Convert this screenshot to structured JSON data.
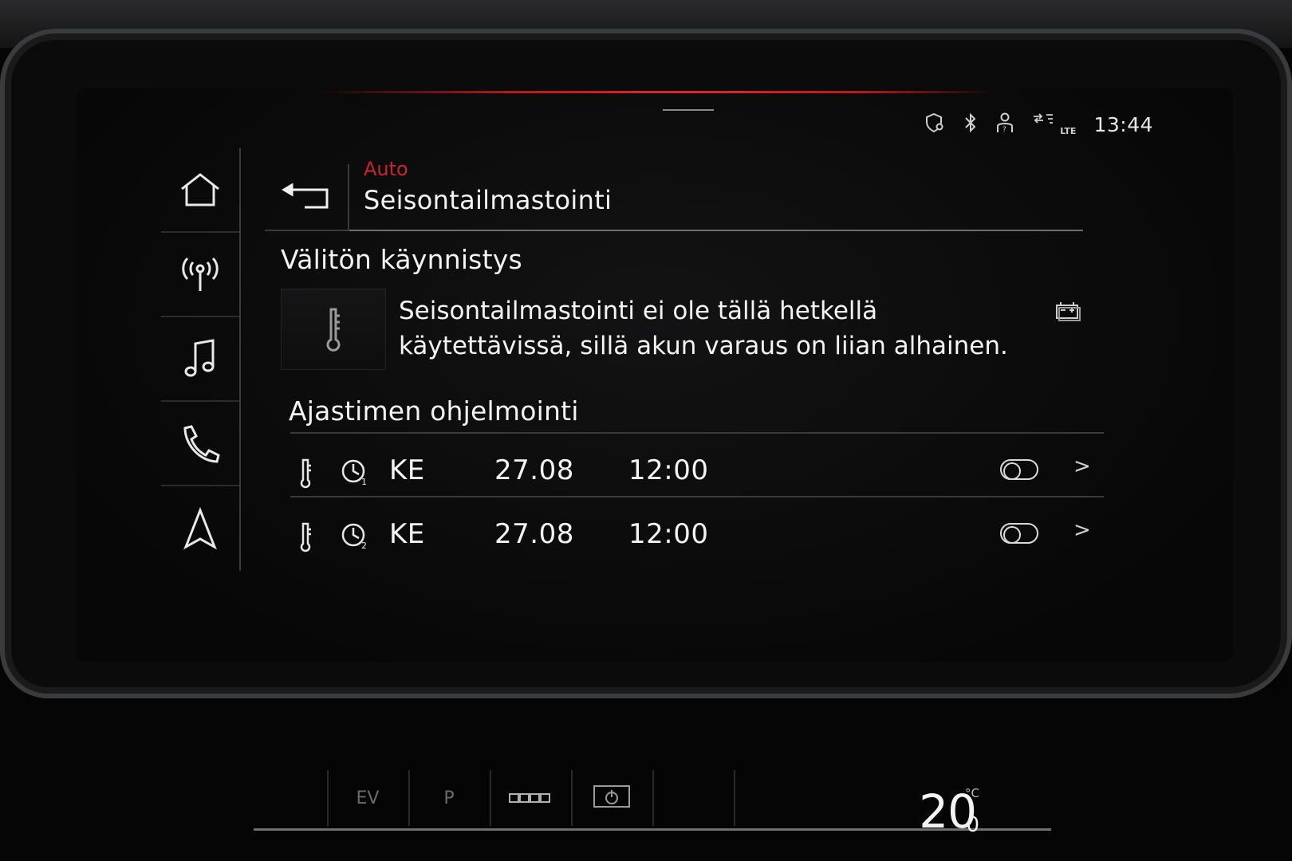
{
  "status_bar": {
    "time": "13:44",
    "icons": [
      "location-shield-icon",
      "bluetooth-icon",
      "user-icon",
      "lte-signal-icon"
    ],
    "lte_label": "LTE"
  },
  "nav": {
    "items": [
      {
        "name": "home-icon"
      },
      {
        "name": "radio-icon"
      },
      {
        "name": "music-icon"
      },
      {
        "name": "phone-icon"
      },
      {
        "name": "navigation-icon"
      }
    ]
  },
  "header": {
    "breadcrumb": "Auto",
    "title": "Seisontailmastointi"
  },
  "instant_start": {
    "heading": "Välitön käynnistys",
    "message": "Seisontailmastointi ei ole tällä hetkellä käytettävissä, sillä akun varaus on liian alhainen."
  },
  "timer_programming": {
    "heading": "Ajastimen ohjelmointi",
    "timers": [
      {
        "clock_index": "1",
        "day": "KE",
        "date": "27.08",
        "time": "12:00",
        "enabled": false
      },
      {
        "clock_index": "2",
        "day": "KE",
        "date": "27.08",
        "time": "12:00",
        "enabled": false
      }
    ]
  },
  "climate": {
    "labels": [
      "EV",
      "P"
    ],
    "temperature": "20",
    "temperature_decimal": "0",
    "unit": "°C"
  },
  "colors": {
    "accent_red": "#c8262c",
    "background": "#070707",
    "text": "#f4f4f4"
  }
}
